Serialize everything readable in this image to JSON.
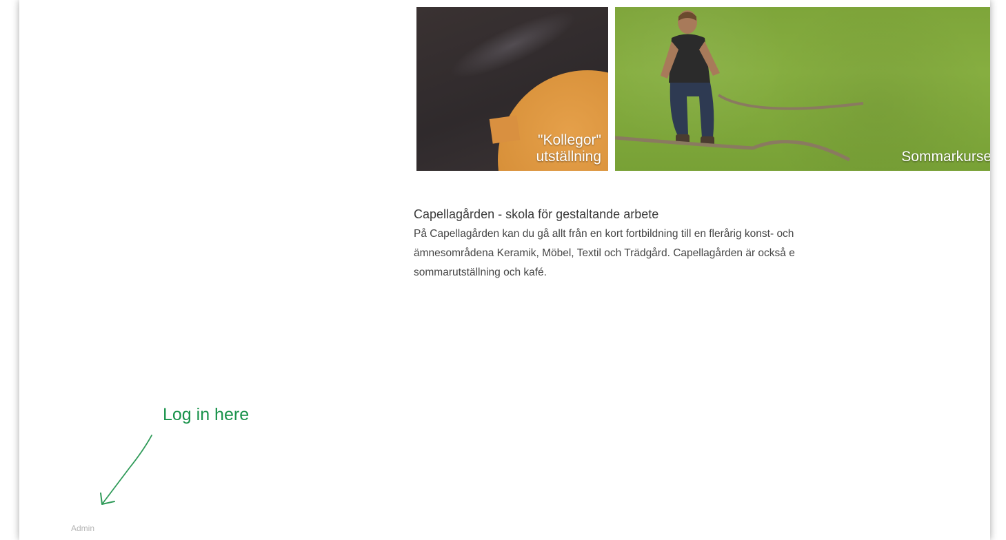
{
  "tiles": [
    {
      "caption_line1": "\"Kollegor\"",
      "caption_line2": "utställning"
    },
    {
      "caption": "Sommarkurse"
    }
  ],
  "intro": {
    "heading": "Capellagården - skola för gestaltande arbete",
    "line1": "På Capellagården kan du gå allt från en kort fortbildning till en flerårig konst- och",
    "line2": "ämnesområdena Keramik, Möbel, Textil och Trädgård. Capellagården är också e",
    "line3": "sommarutställning och kafé."
  },
  "annotation": {
    "text": "Log in here",
    "color": "#18924a"
  },
  "footer": {
    "admin_label": "Admin"
  }
}
